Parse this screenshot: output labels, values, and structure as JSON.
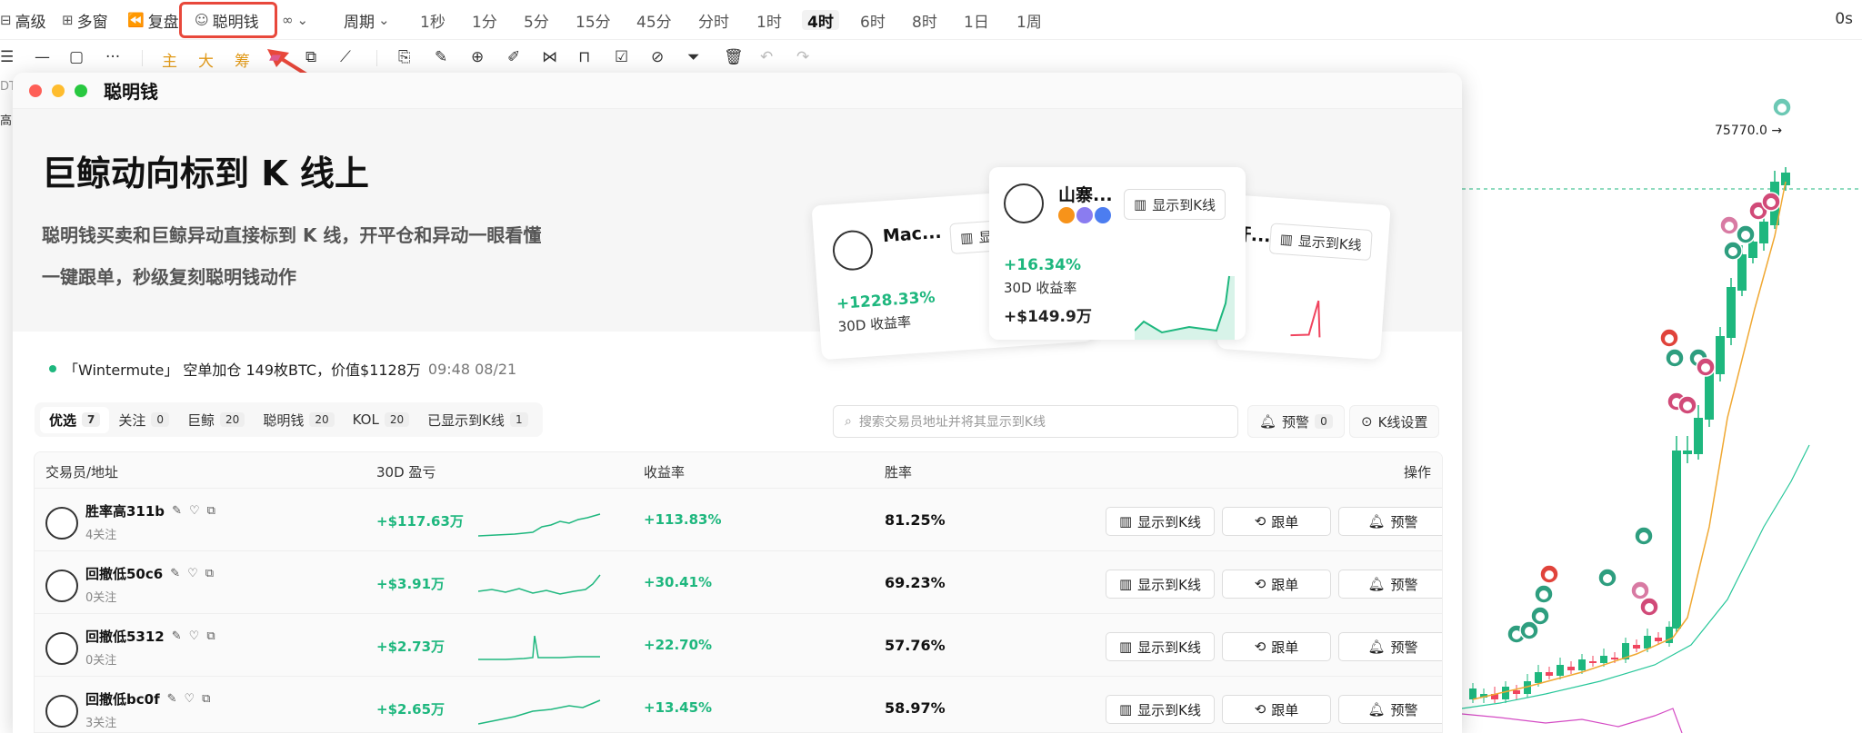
{
  "toolbar": {
    "advanced": "高级",
    "multi_window": "多窗",
    "replay": "复盘",
    "smart_money": "聪明钱",
    "period": "周期",
    "periods": [
      "1秒",
      "1分",
      "5分",
      "15分",
      "45分",
      "分时",
      "1时",
      "4时",
      "6时",
      "8时",
      "1日",
      "1周"
    ],
    "active_period": "4时",
    "countdown": "0s"
  },
  "drawing_toolbar": {
    "main": "主",
    "big": "大",
    "chips": "筹"
  },
  "chart": {
    "price_marker": "75770.0",
    "colors": {
      "up": "#1eb77e",
      "down": "#f0445e",
      "ma": "#f0a832",
      "band": "#28c79a",
      "vol": "#d44bc4"
    }
  },
  "left_stub": {
    "a": "DT",
    "b": "高"
  },
  "modal": {
    "title": "聪明钱",
    "hero": {
      "heading": "巨鲸动向标到 K 线上",
      "line1": "聪明钱买卖和巨鲸异动直接标到 K 线，开平仓和异动一眼看懂",
      "line2": "一键跟单，秒级复刻聪明钱动作"
    },
    "preview_cards": [
      {
        "name": "Mac...",
        "pct": "+1228.33%",
        "label": "30D 收益率",
        "btn": "显"
      },
      {
        "name": "山寨...",
        "pct": "+16.34%",
        "label": "30D 收益率",
        "amount": "+$149.9万",
        "btn": "显示到K线"
      },
      {
        "name": "杆...",
        "btn": "显示到K线"
      }
    ],
    "ticker": {
      "text": "「Wintermute」 空单加仓 149枚BTC，价值$1128万",
      "time": "09:48 08/21"
    },
    "tabs": [
      {
        "label": "优选",
        "count": "7"
      },
      {
        "label": "关注",
        "count": "0"
      },
      {
        "label": "巨鲸",
        "count": "20"
      },
      {
        "label": "聪明钱",
        "count": "20"
      },
      {
        "label": "KOL",
        "count": "20"
      },
      {
        "label": "已显示到K线",
        "count": "1"
      }
    ],
    "search_placeholder": "搜索交易员地址并将其显示到K线",
    "alert_label": "预警",
    "alert_count": "0",
    "kline_settings": "K线设置",
    "columns": {
      "trader": "交易员/地址",
      "pnl": "30D 盈亏",
      "roi": "收益率",
      "winrate": "胜率",
      "action": "操作"
    },
    "row_buttons": {
      "show": "显示到K线",
      "follow": "跟单",
      "alert": "预警"
    },
    "rows": [
      {
        "name": "胜率高311b",
        "followers": "4关注",
        "pnl": "+$117.63万",
        "roi": "+113.83%",
        "winrate": "81.25%"
      },
      {
        "name": "回撤低50c6",
        "followers": "0关注",
        "pnl": "+$3.91万",
        "roi": "+30.41%",
        "winrate": "69.23%"
      },
      {
        "name": "回撤低5312",
        "followers": "0关注",
        "pnl": "+$2.73万",
        "roi": "+22.70%",
        "winrate": "57.76%"
      },
      {
        "name": "回撤低bc0f",
        "followers": "3关注",
        "pnl": "+$2.65万",
        "roi": "+13.45%",
        "winrate": "58.97%"
      }
    ]
  }
}
